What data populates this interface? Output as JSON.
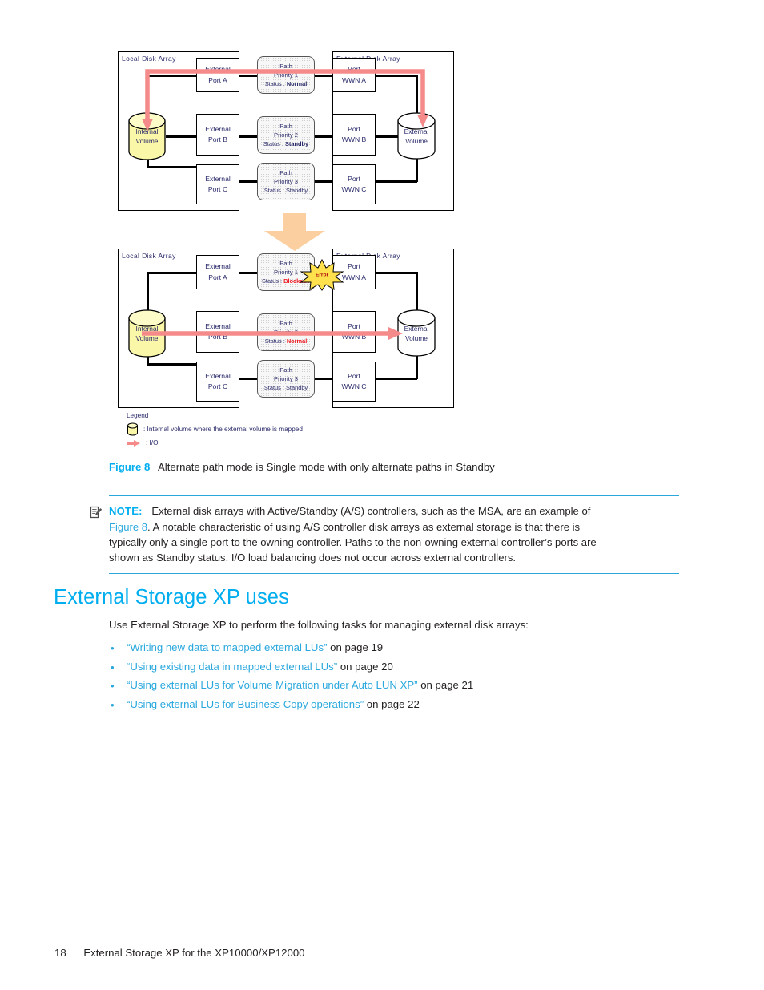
{
  "figure": {
    "diagrams": [
      {
        "id": "before",
        "local_array_label": "Local Disk Array",
        "external_array_label": "External Disk Array",
        "internal_volume": "Internal\nVolume",
        "external_volume": "External\nVolume",
        "local_ports": [
          "External\nPort A",
          "External\nPort B",
          "External\nPort C"
        ],
        "paths": [
          {
            "title": "Path",
            "priority": "Priority 1",
            "status_label": "Status :",
            "status_value": "Normal",
            "status_bold": true,
            "status_red": false
          },
          {
            "title": "Path",
            "priority": "Priority 2",
            "status_label": "Status :",
            "status_value": "Standby",
            "status_bold": true,
            "status_red": false
          },
          {
            "title": "Path",
            "priority": "Priority 3",
            "status_label": "Status :",
            "status_value": "Standby",
            "status_bold": false,
            "status_red": false
          }
        ],
        "external_ports": [
          "Port\nWWN A",
          "Port\nWWN B",
          "Port\nWWN C"
        ],
        "error_burst": null,
        "io_path": "priority1"
      },
      {
        "id": "after",
        "local_array_label": "Local Disk Array",
        "external_array_label": "External Disk Array",
        "internal_volume": "Internal\nVolume",
        "external_volume": "External\nVolume",
        "local_ports": [
          "External\nPort A",
          "External\nPort B",
          "External\nPort C"
        ],
        "paths": [
          {
            "title": "Path",
            "priority": "Priority 1",
            "status_label": "Status :",
            "status_value": "Blockade",
            "status_bold": true,
            "status_red": true
          },
          {
            "title": "Path",
            "priority": "Priority 2",
            "status_label": "Status :",
            "status_value": "Normal",
            "status_bold": true,
            "status_red": true
          },
          {
            "title": "Path",
            "priority": "Priority 3",
            "status_label": "Status :",
            "status_value": "Standby",
            "status_bold": false,
            "status_red": false
          }
        ],
        "external_ports": [
          "Port\nWWN A",
          "Port\nWWN B",
          "Port\nWWN C"
        ],
        "error_burst": "Error",
        "io_path": "priority2"
      }
    ],
    "legend": {
      "title": "Legend",
      "items": [
        {
          "icon": "cylinder-icon",
          "text": ": Internal volume where the external volume is  mapped"
        },
        {
          "icon": "io-arrow-icon",
          "text": ": I/O"
        }
      ]
    },
    "caption": {
      "label": "Figure 8",
      "text": "Alternate path mode is Single mode with only alternate paths in Standby"
    }
  },
  "note": {
    "icon": "note-pencil-icon",
    "lead": "NOTE:",
    "line1_a": "External disk arrays with Active/Standby (A/S) controllers, such as the MSA, are an example of",
    "xref": "Figure 8",
    "line2_rest": ". A notable characteristic of using A/S controller disk arrays as external storage is that there is",
    "line3": "typically only a single port to the owning controller. Paths to the non-owning external controller’s ports are",
    "line4": "shown as Standby status. I/O load balancing does not occur across external controllers."
  },
  "section": {
    "heading": "External Storage XP uses",
    "intro": "Use External Storage XP to perform the following tasks for managing external disk arrays:",
    "bullets": [
      {
        "bullet": "•",
        "link": "“Writing new data to mapped external LUs”",
        "tail": " on page 19"
      },
      {
        "bullet": "•",
        "link": "“Using existing data in mapped external LUs”",
        "tail": " on page 20"
      },
      {
        "bullet": "•",
        "link": "“Using external LUs for Volume Migration under Auto LUN XP”",
        "tail": " on page 21"
      },
      {
        "bullet": "•",
        "link": "“Using external LUs for Business Copy operations”",
        "tail": " on page 22"
      }
    ]
  },
  "footer": {
    "page_number": "18",
    "title": "External Storage XP for the XP10000/XP12000"
  },
  "colors": {
    "accent_cyan": "#00aeef",
    "link_blue": "#2aa8dd",
    "io_arrow_pink": "#f58a8a",
    "transition_arrow_orange": "#fbcfa0",
    "volume_yellow": "#fbf7a8",
    "status_red": "#ef1c24",
    "text_dark": "#231f20",
    "diagram_text_navy": "#2a2a6a"
  }
}
